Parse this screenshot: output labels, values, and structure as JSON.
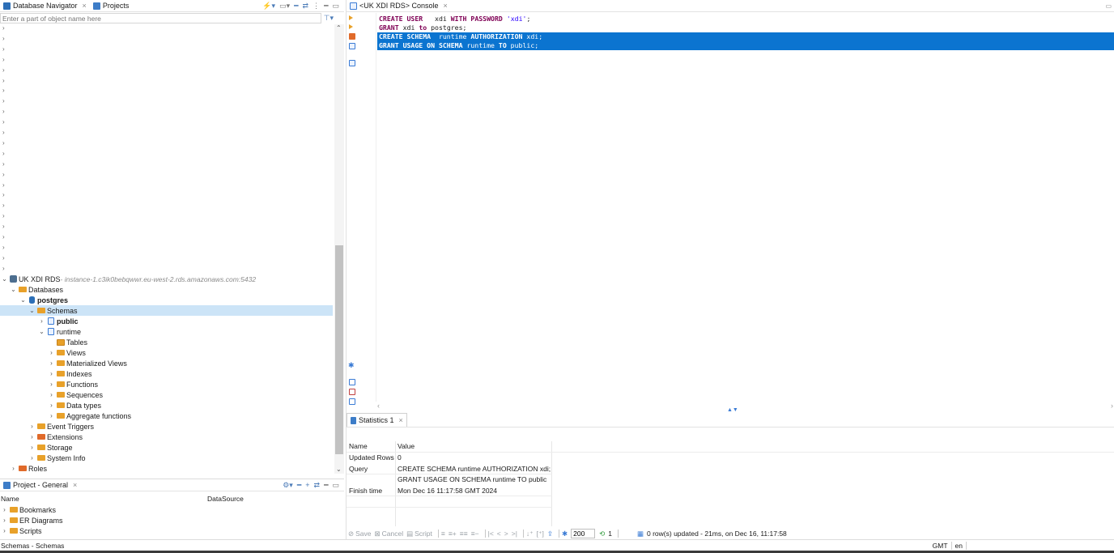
{
  "navigator": {
    "tab_label": "Database Navigator",
    "projects_tab_label": "Projects",
    "filter_placeholder": "Enter a part of object name here",
    "connection": {
      "name": "UK XDI RDS",
      "host": " - instance-1.c3ik0bebqwwr.eu-west-2.rds.amazonaws.com:5432"
    },
    "tree": {
      "databases": "Databases",
      "postgres": "postgres",
      "schemas": "Schemas",
      "public": "public",
      "runtime": "runtime",
      "tables": "Tables",
      "views": "Views",
      "mat_views": "Materialized Views",
      "indexes": "Indexes",
      "functions": "Functions",
      "sequences": "Sequences",
      "data_types": "Data types",
      "aggregate_functions": "Aggregate functions",
      "event_triggers": "Event Triggers",
      "extensions": "Extensions",
      "storage": "Storage",
      "system_info": "System Info",
      "roles": "Roles"
    }
  },
  "project": {
    "tab_label": "Project - General",
    "col_name": "Name",
    "col_datasource": "DataSource",
    "items": [
      "Bookmarks",
      "ER Diagrams",
      "Scripts"
    ]
  },
  "editor": {
    "tab_label": "<UK XDI RDS> Console",
    "lines": [
      {
        "kw1": "CREATE USER",
        "rest1": "   xdi ",
        "kw2": "WITH PASSWORD",
        "rest2": " ",
        "str": "'xdi'",
        "end": ";"
      },
      {
        "kw1": "GRANT",
        "rest1": " xdi ",
        "kw2": "to",
        "rest2": " postgres",
        "str": "",
        "end": ";"
      },
      {
        "kw1": "CREATE SCHEMA",
        "rest1": "  runtime ",
        "kw2": "AUTHORIZATION",
        "rest2": " xdi",
        "str": "",
        "end": ";"
      },
      {
        "kw1": "GRANT USAGE ON SCHEMA",
        "rest1": " runtime ",
        "kw2": "TO",
        "rest2": " public",
        "str": "",
        "end": ";"
      }
    ]
  },
  "results": {
    "tab_label": "Statistics 1",
    "col_name": "Name",
    "col_value": "Value",
    "rows": [
      {
        "name": "Updated Rows",
        "value": "0"
      },
      {
        "name": "Query",
        "value": "CREATE SCHEMA  runtime AUTHORIZATION xdi;"
      },
      {
        "name": "",
        "value": "GRANT USAGE ON SCHEMA runtime TO public"
      },
      {
        "name": "Finish time",
        "value": "Mon Dec 16 11:17:58 GMT 2024"
      }
    ],
    "toolbar": {
      "save": "Save",
      "cancel": "Cancel",
      "script": "Script",
      "fetch_size": "200",
      "refresh_count": "1",
      "status": "0 row(s) updated - 21ms, on Dec 16, 11:17:58"
    }
  },
  "statusbar": {
    "left": "Schemas - Schemas",
    "tz": "GMT",
    "locale": "en"
  },
  "colors": {
    "selection": "#0b74d0",
    "tree_selection": "#cce4f7",
    "keyword": "#7f0055",
    "string": "#2a00ff"
  }
}
